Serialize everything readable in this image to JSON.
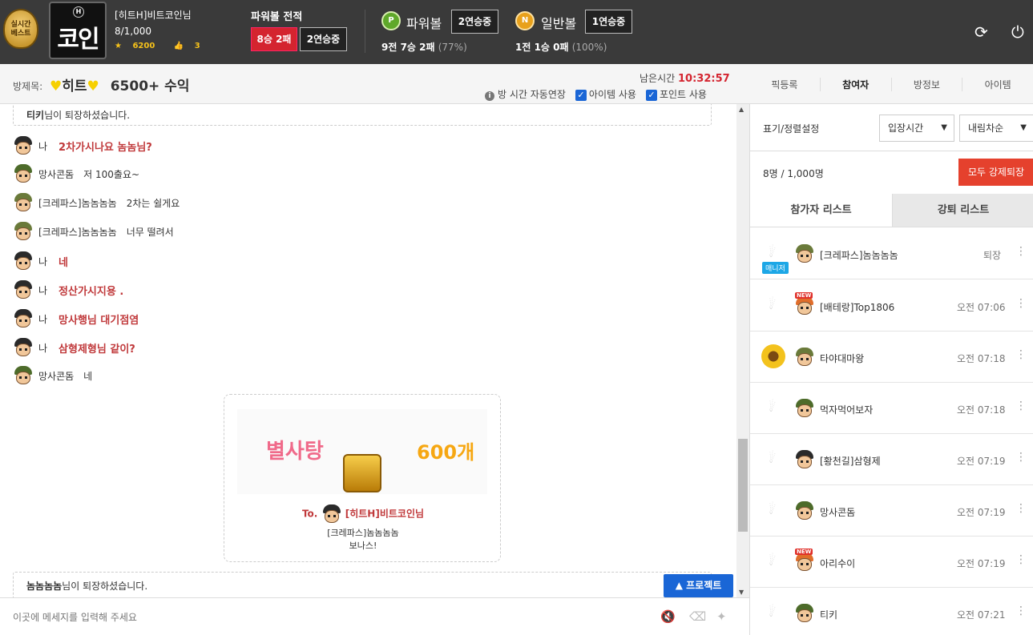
{
  "topbar": {
    "live_badge": "실시간\n베스트",
    "logo_text": "코인",
    "logo_mini": "H",
    "user_name": "[히트H]비트코인님",
    "user_count": "8/1,000",
    "stars": "6200",
    "likes": "3",
    "powerball_title": "파워볼 전적",
    "record_red": "8승 2패",
    "record_streak": "2연승중",
    "games": [
      {
        "ball": "P",
        "name": "파워볼",
        "streak": "2연승중",
        "record": "9전 7승 2패",
        "pct": "(77%)"
      },
      {
        "ball": "N",
        "name": "일반볼",
        "streak": "1연승중",
        "record": "1전 1승 0패",
        "pct": "(100%)"
      }
    ]
  },
  "subbar": {
    "room_label": "방제목:",
    "room_title": "히트",
    "room_suffix": "6500+ 수익",
    "timer_label": "남은시간",
    "timer_value": "10:32:57",
    "opt_auto": "방 시간 자동연장",
    "opt_item": "아이템 사용",
    "opt_point": "포인트 사용",
    "tabs": [
      "픽등록",
      "참여자",
      "방정보",
      "아이템"
    ]
  },
  "chat": {
    "sys_top_name": "티키",
    "sys_top_text": "님이 퇴장하셨습니다.",
    "messages": [
      {
        "me": true,
        "who": "나",
        "text": "2차가시나요 놈놈님?",
        "avatar": "black"
      },
      {
        "me": false,
        "who": "망사콘돔",
        "text": "저 100출요~",
        "avatar": "green"
      },
      {
        "me": false,
        "who": "[크레파스]놈놈놈놈",
        "text": "2차는 쉴게요",
        "avatar": "olive"
      },
      {
        "me": false,
        "who": "[크레파스]놈놈놈놈",
        "text": "너무 떨려서",
        "avatar": "olive"
      },
      {
        "me": true,
        "who": "나",
        "text": "네",
        "avatar": "black"
      },
      {
        "me": true,
        "who": "나",
        "text": "정산가시지용 .",
        "avatar": "black"
      },
      {
        "me": true,
        "who": "나",
        "text": "망사행님 대기점염",
        "avatar": "black"
      },
      {
        "me": true,
        "who": "나",
        "text": "삼형제형님 같이?",
        "avatar": "black"
      },
      {
        "me": false,
        "who": "망사콘돔",
        "text": "네",
        "avatar": "green"
      }
    ],
    "gift": {
      "item_name": "별사탕",
      "item_count": "600개",
      "to_label": "To.",
      "to_name": "[히트H]비트코인님",
      "from_name": "[크레파스]놈놈놈놈",
      "bonus": "보나스!"
    },
    "sys_bottom_name": "놈놈놈놈",
    "sys_bottom_text": "님이 퇴장하셨습니다.",
    "project_button": "프로젝트",
    "input_placeholder": "이곳에 메세지를 입력해 주세요"
  },
  "panel": {
    "sort_label": "표기/정렬설정",
    "sort_select": "입장시간",
    "order_select": "내림차순",
    "count": "8명 / 1,000명",
    "kick_all": "모두 강제퇴장",
    "tab_participants": "참가자 리스트",
    "tab_kicked": "강퇴 리스트",
    "manager_tag": "매니저",
    "participants": [
      {
        "name": "[크레파스]놈놈놈놈",
        "time": "퇴장",
        "avatar": "olive",
        "manager": true,
        "isnew": false,
        "sunflower": false
      },
      {
        "name": "[배테랑]Top1806",
        "time": "오전 07:06",
        "avatar": "orange",
        "manager": false,
        "isnew": true,
        "sunflower": false
      },
      {
        "name": "타야대마왕",
        "time": "오전 07:18",
        "avatar": "olive",
        "manager": false,
        "isnew": false,
        "sunflower": true
      },
      {
        "name": "먹자먹어보자",
        "time": "오전 07:18",
        "avatar": "green",
        "manager": false,
        "isnew": false,
        "sunflower": false
      },
      {
        "name": "[황천길]삼형제",
        "time": "오전 07:19",
        "avatar": "black",
        "manager": false,
        "isnew": false,
        "sunflower": false
      },
      {
        "name": "망사콘돔",
        "time": "오전 07:19",
        "avatar": "green",
        "manager": false,
        "isnew": false,
        "sunflower": false
      },
      {
        "name": "아리수이",
        "time": "오전 07:19",
        "avatar": "orange",
        "manager": false,
        "isnew": true,
        "sunflower": false
      },
      {
        "name": "티키",
        "time": "오전 07:21",
        "avatar": "green",
        "manager": false,
        "isnew": false,
        "sunflower": false
      }
    ]
  }
}
